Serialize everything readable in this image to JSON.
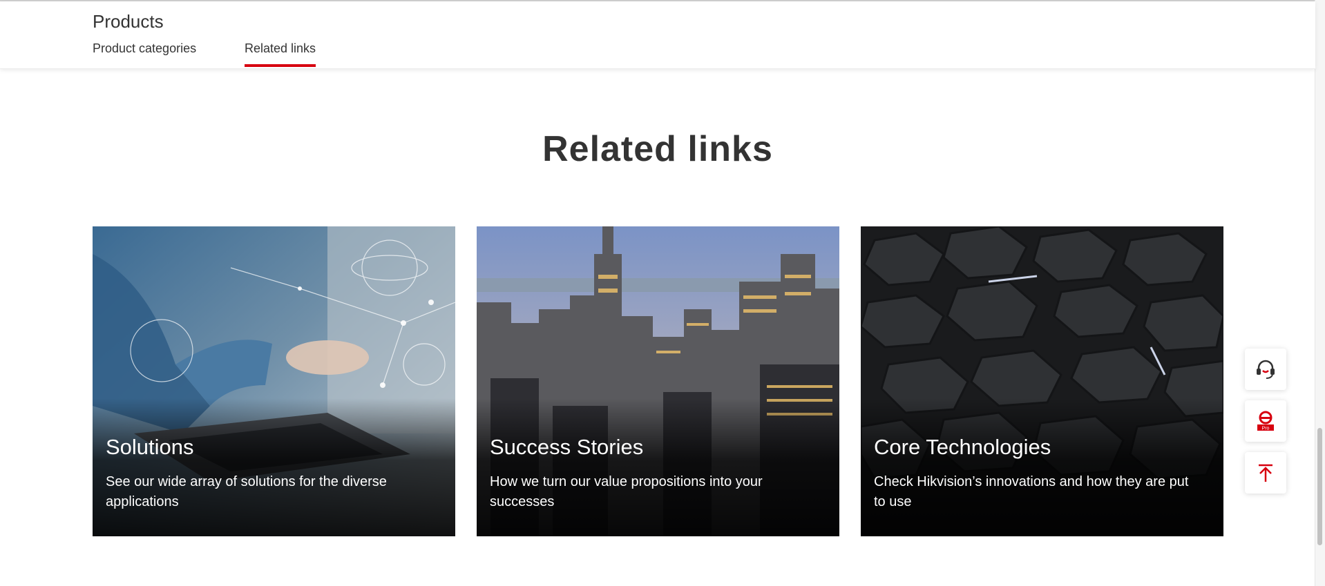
{
  "subnav": {
    "title": "Products",
    "tabs": [
      {
        "label": "Product categories",
        "active": false
      },
      {
        "label": "Related links",
        "active": true
      }
    ],
    "accent_color": "#d7000f"
  },
  "section": {
    "heading": "Related links"
  },
  "cards": [
    {
      "title": "Solutions",
      "description": "See our wide array of solutions for the diverse applications",
      "image": "laptop-network-photo"
    },
    {
      "title": "Success Stories",
      "description": "How we turn our value propositions into your successes",
      "image": "city-skyline-photo"
    },
    {
      "title": "Core Technologies",
      "description": "Check Hikvision’s innovations and how they are put to use",
      "image": "hexagon-tiles-photo"
    }
  ],
  "float_bar": {
    "buttons": [
      {
        "icon": "headset-icon"
      },
      {
        "icon": "hikvision-pro-icon",
        "badge": "Pro"
      },
      {
        "icon": "back-to-top-icon"
      }
    ]
  }
}
